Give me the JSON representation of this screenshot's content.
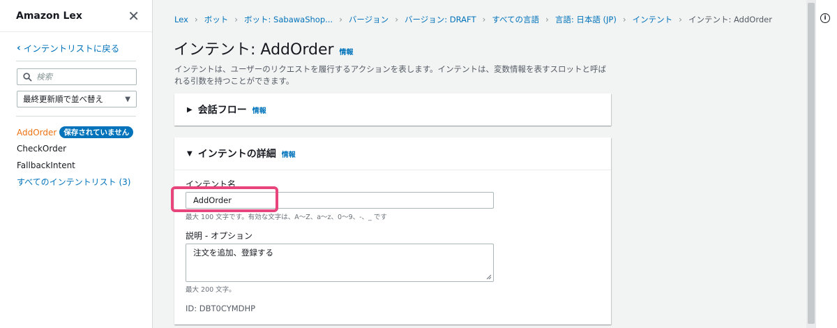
{
  "sidebar": {
    "title": "Amazon Lex",
    "back_link": "インテントリストに戻る",
    "search_placeholder": "検索",
    "sort_label": "最終更新順で並べ替え",
    "intents": [
      {
        "name": "AddOrder",
        "badge": "保存されていません"
      },
      {
        "name": "CheckOrder"
      },
      {
        "name": "FallbackIntent"
      }
    ],
    "all_intents_link": "すべてのインテントリスト (3)"
  },
  "breadcrumb": [
    "Lex",
    "ボット",
    "ボット: SabawaShop...",
    "バージョン",
    "バージョン: DRAFT",
    "すべての言語",
    "言語: 日本語 (JP)",
    "インテント",
    "インテント: AddOrder"
  ],
  "header": {
    "title": "インテント: AddOrder",
    "info": "情報",
    "description": "インテントは、ユーザーのリクエストを履行するアクションを表します。インテントは、変数情報を表すスロットと呼ばれる引数を持つことができます。"
  },
  "conversation_flow": {
    "title": "会話フロー",
    "info": "情報"
  },
  "intent_details": {
    "title": "インテントの詳細",
    "info": "情報",
    "name_label": "インテント名",
    "name_value": "AddOrder",
    "name_hint": "最大 100 文字です。有効な文字は、A～Z、a～z、0～9、-、_ です",
    "desc_label": "説明 - オプション",
    "desc_value": "注文を追加、登録する",
    "desc_hint": "最大 200 文字。",
    "id_line": "ID: DBT0CYMDHP"
  },
  "colors": {
    "link": "#0073bb",
    "active": "#ec7211",
    "highlight": "#e8457c"
  }
}
